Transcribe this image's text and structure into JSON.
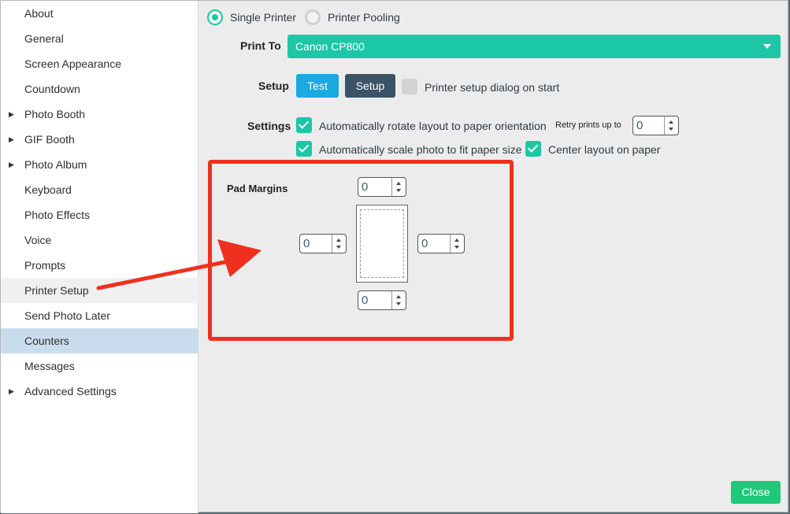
{
  "sidebar": {
    "items": [
      {
        "label": "About",
        "expandable": false
      },
      {
        "label": "General",
        "expandable": false
      },
      {
        "label": "Screen Appearance",
        "expandable": false
      },
      {
        "label": "Countdown",
        "expandable": false
      },
      {
        "label": "Photo Booth",
        "expandable": true
      },
      {
        "label": "GIF Booth",
        "expandable": true
      },
      {
        "label": "Photo Album",
        "expandable": true
      },
      {
        "label": "Keyboard",
        "expandable": false
      },
      {
        "label": "Photo Effects",
        "expandable": false
      },
      {
        "label": "Voice",
        "expandable": false
      },
      {
        "label": "Prompts",
        "expandable": false
      },
      {
        "label": "Printer Setup",
        "expandable": false,
        "state": "hover"
      },
      {
        "label": "Send Photo Later",
        "expandable": false
      },
      {
        "label": "Counters",
        "expandable": false,
        "state": "selected"
      },
      {
        "label": "Messages",
        "expandable": false
      },
      {
        "label": "Advanced Settings",
        "expandable": true
      }
    ],
    "expand_icon": "triangle-right-icon"
  },
  "printer_mode": {
    "single": "Single Printer",
    "pooling": "Printer Pooling",
    "selected": "single"
  },
  "print_to": {
    "label": "Print To",
    "value": "Canon CP800"
  },
  "setup": {
    "label": "Setup",
    "test_button": "Test",
    "setup_button": "Setup",
    "dialog_on_start_label": "Printer setup dialog on start",
    "dialog_on_start_checked": false
  },
  "settings": {
    "label": "Settings",
    "auto_rotate_label": "Automatically rotate layout to paper orientation",
    "auto_rotate_checked": true,
    "retry_label": "Retry prints up to",
    "retry_value": "0",
    "auto_scale_label": "Automatically scale photo to fit paper size",
    "auto_scale_checked": true,
    "center_label": "Center layout on paper",
    "center_checked": true
  },
  "pad_margins": {
    "label": "Pad Margins",
    "top": "0",
    "left": "0",
    "right": "0",
    "bottom": "0"
  },
  "footer": {
    "close_button": "Close"
  },
  "colors": {
    "accent": "#1cc7a6",
    "test_button": "#1aa9e0",
    "setup_button": "#3a5366",
    "close_button": "#1ec97a",
    "annotation": "#f0301e",
    "selected_nav": "#c9dced"
  }
}
